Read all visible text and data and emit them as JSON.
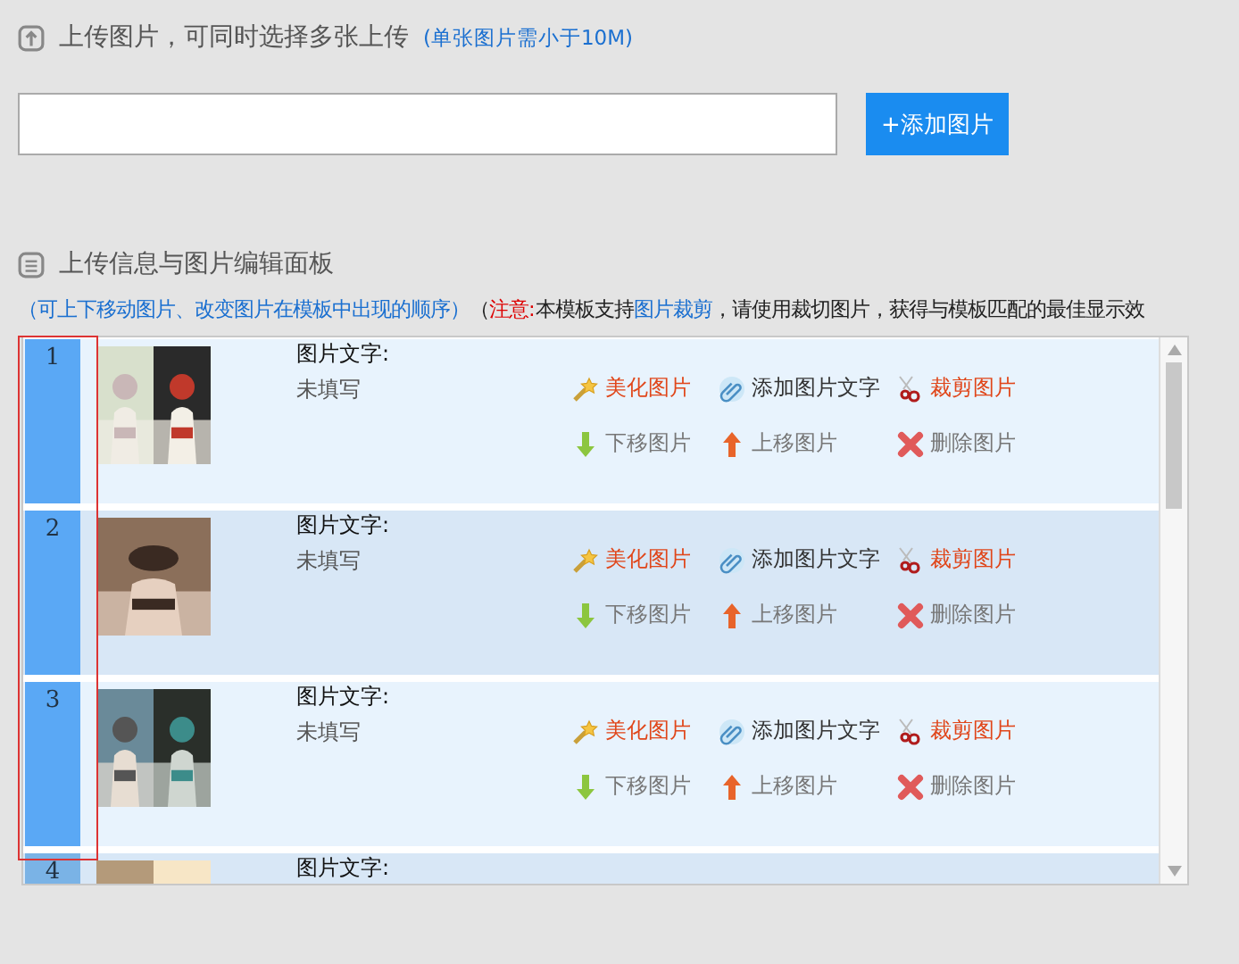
{
  "upload": {
    "title": "上传图片，可同时选择多张上传",
    "hint": "(单张图片需小于10M)",
    "button": "+添加图片"
  },
  "panel": {
    "title": "上传信息与图片编辑面板",
    "note": [
      {
        "kind": "hint",
        "text": "（可上下移动图片、改变图片在模板中出现的顺序）"
      },
      {
        "kind": "plain",
        "text": "（"
      },
      {
        "kind": "warning",
        "text": "注意:"
      },
      {
        "kind": "plain",
        "text": "本模板支持"
      },
      {
        "kind": "link",
        "text": "图片裁剪"
      },
      {
        "kind": "plain",
        "text": "，请使用裁切图片，获得与模板匹配的最佳显示效"
      }
    ]
  },
  "rows": [
    {
      "number": "1",
      "caption_label": "图片文字:",
      "caption": "未填写",
      "highlighted": true,
      "actions": [
        {
          "kind": "beautify",
          "label": "美化图片"
        },
        {
          "kind": "add_text",
          "label": "添加图片文字"
        },
        {
          "kind": "crop",
          "label": "裁剪图片"
        },
        {
          "kind": "move_down",
          "label": "下移图片"
        },
        {
          "kind": "move_up",
          "label": "上移图片"
        },
        {
          "kind": "delete",
          "label": "删除图片"
        }
      ]
    },
    {
      "number": "2",
      "caption_label": "图片文字:",
      "caption": "未填写",
      "highlighted": true,
      "actions": [
        {
          "kind": "beautify",
          "label": "美化图片"
        },
        {
          "kind": "add_text",
          "label": "添加图片文字"
        },
        {
          "kind": "crop",
          "label": "裁剪图片"
        },
        {
          "kind": "move_down",
          "label": "下移图片"
        },
        {
          "kind": "move_up",
          "label": "上移图片"
        },
        {
          "kind": "delete",
          "label": "删除图片"
        }
      ]
    },
    {
      "number": "3",
      "caption_label": "图片文字:",
      "caption": "未填写",
      "highlighted": true,
      "actions": [
        {
          "kind": "beautify",
          "label": "美化图片"
        },
        {
          "kind": "add_text",
          "label": "添加图片文字"
        },
        {
          "kind": "crop",
          "label": "裁剪图片"
        },
        {
          "kind": "move_down",
          "label": "下移图片"
        },
        {
          "kind": "move_up",
          "label": "上移图片"
        },
        {
          "kind": "delete",
          "label": "删除图片"
        }
      ]
    },
    {
      "number": "4",
      "caption_label": "图片文字:",
      "highlighted": false
    }
  ]
}
